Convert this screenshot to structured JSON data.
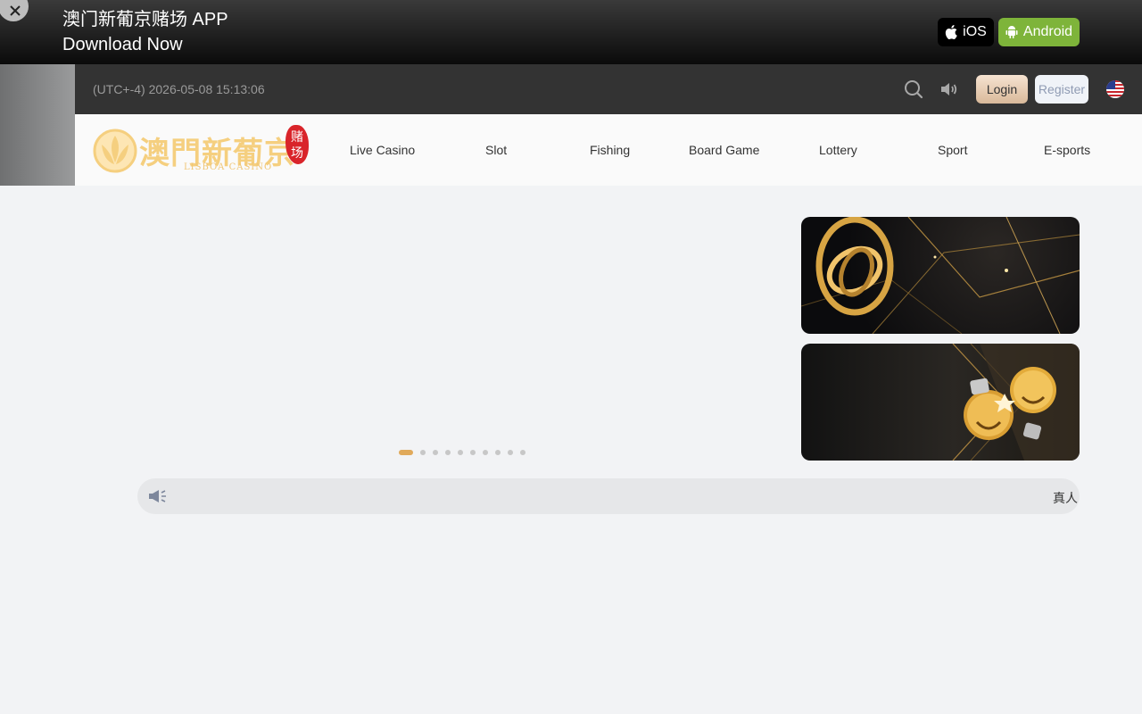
{
  "banner": {
    "title": "澳门新葡京赌场 APP",
    "subtitle": "Download Now",
    "ios_label": "iOS",
    "android_label": "Android",
    "android_color": "#7eb43a"
  },
  "topbar": {
    "clock": "(UTC+-4) 2026-05-08 15:13:06",
    "login_label": "Login",
    "register_label": "Register",
    "icons": [
      "search-icon",
      "speaker-icon",
      "us-flag-icon"
    ]
  },
  "logo": {
    "text": "澳門新葡京",
    "sub": "LISBOA CASINO",
    "seal_top": "赌",
    "seal_bottom": "场",
    "color": "#f5cf7f"
  },
  "nav": {
    "items": [
      "Live Casino",
      "Slot",
      "Fishing",
      "Board Game",
      "Lottery",
      "Sport",
      "E-sports"
    ]
  },
  "carousel": {
    "slides": 10,
    "active": 0,
    "accent": "#e0a95a"
  },
  "marquee": {
    "text": "真人"
  }
}
